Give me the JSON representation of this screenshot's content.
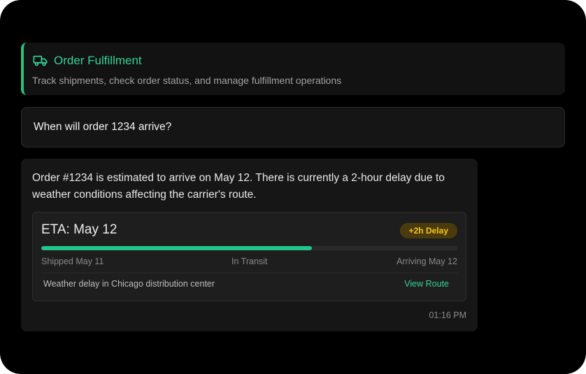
{
  "header": {
    "icon": "truck-icon",
    "title": "Order Fulfillment",
    "subtitle": "Track shipments, check order status, and manage fulfillment operations",
    "accent_color": "#34d399"
  },
  "user_message": {
    "text": "When will order 1234 arrive?"
  },
  "assistant_message": {
    "text": "Order #1234 is estimated to arrive on May 12. There is currently a 2-hour delay due to weather conditions affecting the carrier's route.",
    "timestamp": "01:16 PM",
    "shipment_card": {
      "eta": "ETA: May 12",
      "delay_badge": "+2h Delay",
      "progress_fraction": 0.65,
      "progress_color": "#22c58b",
      "stages": [
        "Shipped May 11",
        "In Transit",
        "Arriving May 12"
      ],
      "note": "Weather delay in Chicago distribution center",
      "view_route_label": "View Route"
    }
  }
}
